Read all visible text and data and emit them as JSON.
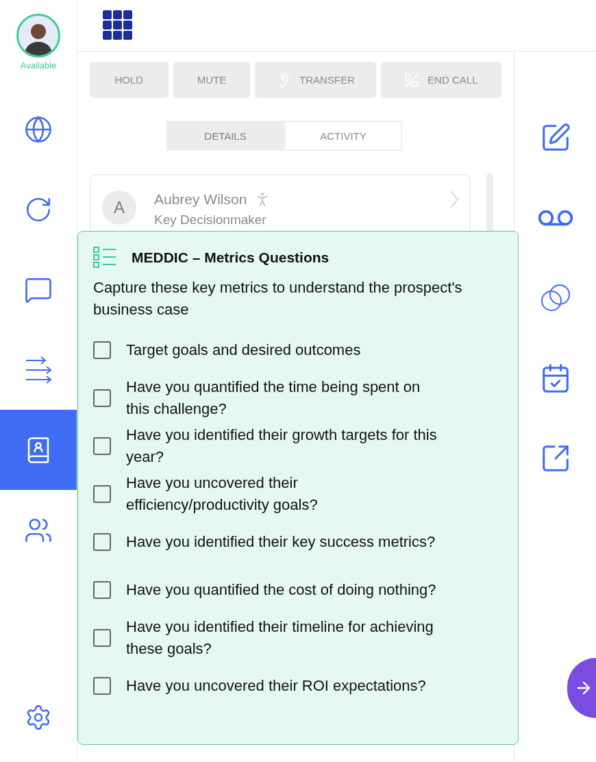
{
  "user": {
    "status": "Available"
  },
  "nav": [
    {
      "kind": "globe",
      "selected": false
    },
    {
      "kind": "refresh",
      "selected": false
    },
    {
      "kind": "chat",
      "selected": false
    },
    {
      "kind": "arrows",
      "selected": false
    },
    {
      "kind": "contacts",
      "selected": true
    },
    {
      "kind": "people",
      "selected": false
    }
  ],
  "call_controls": [
    {
      "kind": "hold",
      "label": "HOLD",
      "disabled": true
    },
    {
      "kind": "mute",
      "label": "MUTE",
      "disabled": true
    },
    {
      "kind": "transfer",
      "label": "TRANSFER",
      "disabled": true
    },
    {
      "kind": "end",
      "label": "END CALL",
      "disabled": true
    }
  ],
  "tabs": [
    {
      "label": "DETAILS",
      "selected": true
    },
    {
      "label": "ACTIVITY",
      "selected": false
    }
  ],
  "contact": {
    "initial": "A",
    "name": "Aubrey Wilson",
    "role": "Key Decisionmaker"
  },
  "checklist": {
    "title": "MEDDIC – Metrics Questions",
    "description": "Capture these key metrics to understand the prospect's business case",
    "items": [
      {
        "label": "Target goals and desired outcomes",
        "checked": false
      },
      {
        "label": "Have you quantified the time being spent on this challenge?",
        "checked": false
      },
      {
        "label": "Have you identified their growth targets for this year?",
        "checked": false
      },
      {
        "label": "Have you uncovered their efficiency/productivity goals?",
        "checked": false
      },
      {
        "label": "Have you identified their key success metrics?",
        "checked": false
      },
      {
        "label": "Have you quantified the cost of doing nothing?",
        "checked": false
      },
      {
        "label": "Have you identified their timeline for achieving these goals?",
        "checked": false
      },
      {
        "label": "Have you uncovered their ROI expectations?",
        "checked": false
      }
    ]
  },
  "right_rail": [
    {
      "kind": "edit"
    },
    {
      "kind": "voicemail"
    },
    {
      "kind": "circles"
    },
    {
      "kind": "calendar"
    },
    {
      "kind": "external"
    }
  ],
  "fab": {
    "kind": "next"
  }
}
